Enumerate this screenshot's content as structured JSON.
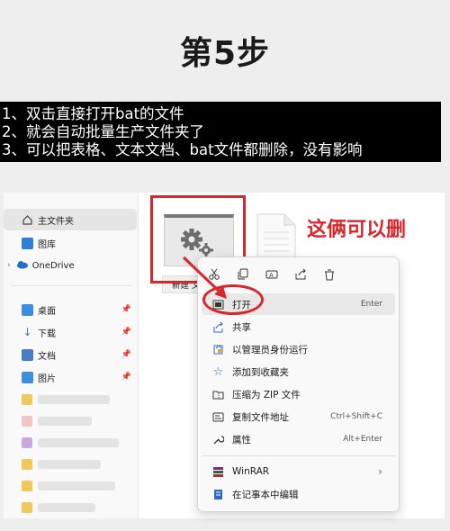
{
  "page": {
    "title": "第5步",
    "steps": [
      "1、双击直接打开bat的文件",
      "2、就会自动批量生产文件夹了",
      "3、可以把表格、文本文档、bat文件都删除，没有影响"
    ],
    "annotation": "这俩可以删"
  },
  "sidebar": {
    "items": [
      {
        "label": "主文件夹",
        "icon": "home-icon"
      },
      {
        "label": "图库",
        "icon": "gallery-icon"
      },
      {
        "label": "OneDrive",
        "icon": "cloud-icon"
      },
      {
        "label": "桌面",
        "icon": "desktop-icon"
      },
      {
        "label": "下载",
        "icon": "download-icon"
      },
      {
        "label": "文档",
        "icon": "document-icon"
      },
      {
        "label": "图片",
        "icon": "picture-icon"
      }
    ]
  },
  "files": {
    "bat_label": "新建 文"
  },
  "context_menu": {
    "toolbar": [
      "cut-icon",
      "copy-icon",
      "rename-icon",
      "share-icon",
      "delete-icon"
    ],
    "items": [
      {
        "label": "打开",
        "shortcut": "Enter",
        "icon": "open-icon"
      },
      {
        "label": "共享",
        "shortcut": "",
        "icon": "share-icon"
      },
      {
        "label": "以管理员身份运行",
        "shortcut": "",
        "icon": "admin-shield-icon"
      },
      {
        "label": "添加到收藏夹",
        "shortcut": "",
        "icon": "star-icon"
      },
      {
        "label": "压缩为 ZIP 文件",
        "shortcut": "",
        "icon": "zip-icon"
      },
      {
        "label": "复制文件地址",
        "shortcut": "Ctrl+Shift+C",
        "icon": "copy-path-icon"
      },
      {
        "label": "属性",
        "shortcut": "Alt+Enter",
        "icon": "wrench-icon"
      },
      {
        "label": "WinRAR",
        "shortcut": "",
        "icon": "winrar-icon"
      },
      {
        "label": "在记事本中编辑",
        "shortcut": "",
        "icon": "notepad-icon"
      }
    ]
  },
  "colors": {
    "highlight_red": "#d9262b",
    "steps_bg": "#000000"
  }
}
